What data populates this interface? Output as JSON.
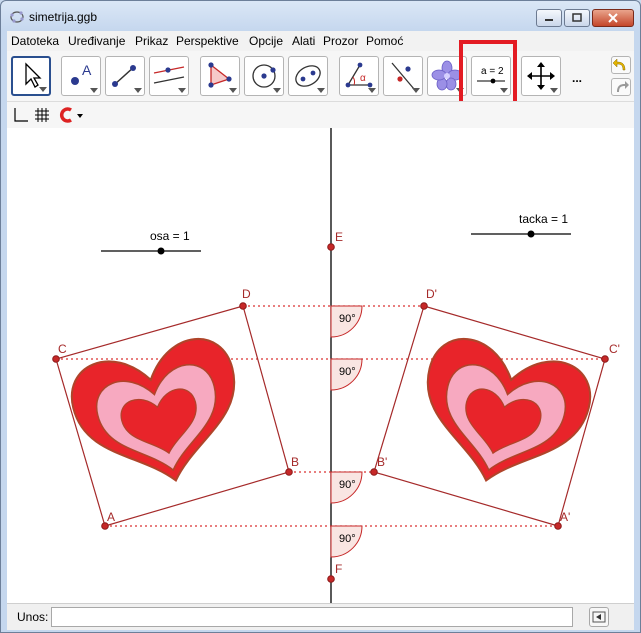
{
  "window": {
    "title": "simetrija.ggb"
  },
  "menu": [
    "Datoteka",
    "Uređivanje",
    "Prikaz",
    "Perspektive",
    "Opcije",
    "Alati",
    "Prozor",
    "Pomoć"
  ],
  "toolbar": {
    "tools": [
      {
        "name": "move-tool-icon"
      },
      {
        "name": "point-tool-icon"
      },
      {
        "name": "segment-tool-icon"
      },
      {
        "name": "parallel-line-tool-icon"
      },
      {
        "name": "polygon-tool-icon"
      },
      {
        "name": "circle-tool-icon"
      },
      {
        "name": "ellipse-tool-icon"
      },
      {
        "name": "angle-tool-icon"
      },
      {
        "name": "reflect-tool-icon"
      },
      {
        "name": "special-object-tool-icon"
      },
      {
        "name": "slider-tool-icon",
        "label": "a = 2"
      },
      {
        "name": "move-view-tool-icon"
      }
    ],
    "more_label": "..."
  },
  "graphics": {
    "sliders": [
      {
        "label": "osa = 1",
        "value": 1
      },
      {
        "label": "tacka = 1",
        "value": 1
      }
    ],
    "points": [
      "A",
      "B",
      "C",
      "D",
      "E",
      "F",
      "A'",
      "B'",
      "C'",
      "D'"
    ],
    "angles": [
      "90°",
      "90°",
      "90°",
      "90°"
    ],
    "colors": {
      "points": "#c62828",
      "polygon": "#a52a2a",
      "heart_outer": "#e8242a",
      "heart_mid": "#f7a9c0",
      "axis": "#000000"
    }
  },
  "input_bar": {
    "label": "Unos:",
    "value": ""
  }
}
